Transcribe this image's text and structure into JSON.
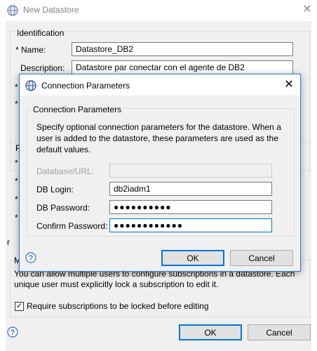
{
  "outer": {
    "title": "New Datastore",
    "close_glyph": "✕",
    "identification": {
      "legend": "Identification",
      "name_label": "* Name:",
      "name_value": "Datastore_DB2",
      "description_label": "Description:",
      "description_value": "Datastore par conectar con el agente de DB2",
      "row_marker": "*"
    },
    "group2_letter": "P",
    "left_markers": [
      "*",
      "*",
      "*",
      "*"
    ],
    "edge_letter_r": "r",
    "multi": {
      "legend_letter": "M",
      "text": "You can allow multiple users to configure subscriptions in a datastore. Each unique user must explicitly lock a subscription to edit it.",
      "checkbox_label": "Require subscriptions to be locked before editing",
      "checkbox_checked": true,
      "check_glyph": "✓"
    },
    "ok_label": "OK",
    "cancel_label": "Cancel"
  },
  "inner": {
    "title": "Connection Parameters",
    "close_glyph": "✕",
    "group_legend": "Connection Parameters",
    "description": "Specify optional connection parameters for the datastore. When a user is added to the datastore, these parameters are used as the default values.",
    "db_url_label": "Database/URL:",
    "db_url_value": "",
    "db_login_label": "DB Login:",
    "db_login_value": "db2iadm1",
    "db_password_label": "DB Password:",
    "db_password_value": "●●●●●●●●●●",
    "confirm_password_label": "Confirm Password:",
    "confirm_password_value": "●●●●●●●●●●●●",
    "ok_label": "OK",
    "cancel_label": "Cancel"
  },
  "colors": {
    "accent": "#0078d7",
    "dialog_bg": "#f0f0f0",
    "button_bg": "#e1e1e1"
  },
  "icons": {
    "app": "app-globe-icon",
    "help": "help-icon",
    "close": "close-icon"
  }
}
